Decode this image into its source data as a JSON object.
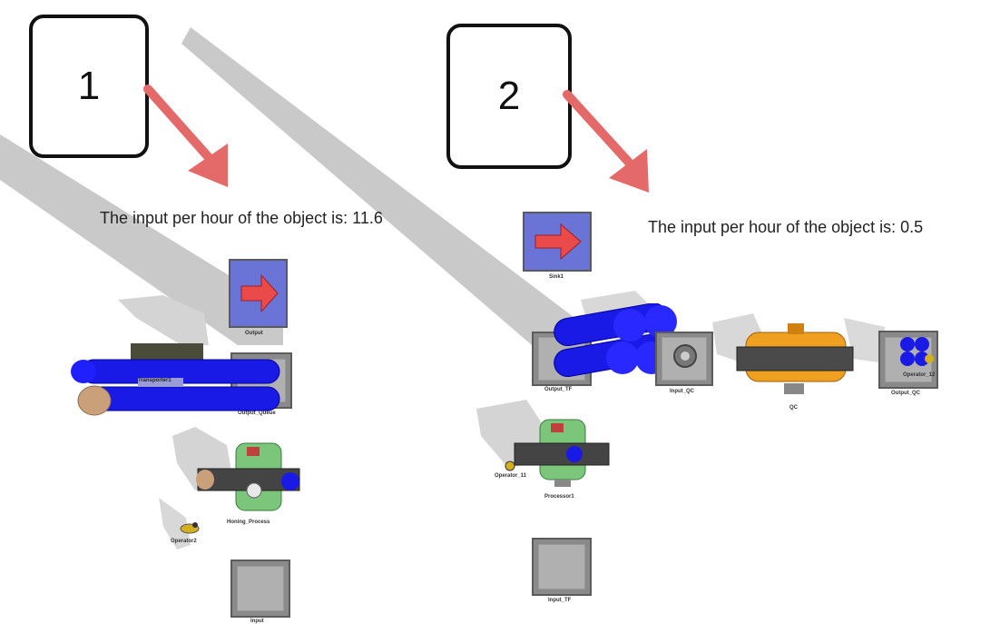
{
  "callouts": [
    {
      "number": "1"
    },
    {
      "number": "2"
    }
  ],
  "readouts": [
    {
      "text": "The input per hour of the object is: 11.6"
    },
    {
      "text": "The input per hour of the object is: 0.5"
    }
  ],
  "scene1": {
    "output_label": "Output",
    "transporter_label": "Transporter1",
    "output_queue_label": "Output_Queue",
    "honing_label": "Honing_Process",
    "operator_label": "Operator2",
    "bottom_label": "Input"
  },
  "scene2": {
    "sink_label": "Sink1",
    "output_tf_label": "Output_TF",
    "input_qc_label": "Input_QC",
    "qc_label": "QC",
    "output_qc_label": "Output_QC",
    "operator12_label": "Operator_12",
    "operator11_label": "Operator_11",
    "processor_label": "Processor1",
    "input_tf_label": "Input_TF"
  },
  "colors": {
    "arrow": "#e46a6a",
    "beam_shadow": "#c8c8c8",
    "cylinder": "#1414e0",
    "sink_face": "#6a73d6",
    "machine_green": "#7bc67b",
    "machine_orange": "#f0a020"
  }
}
